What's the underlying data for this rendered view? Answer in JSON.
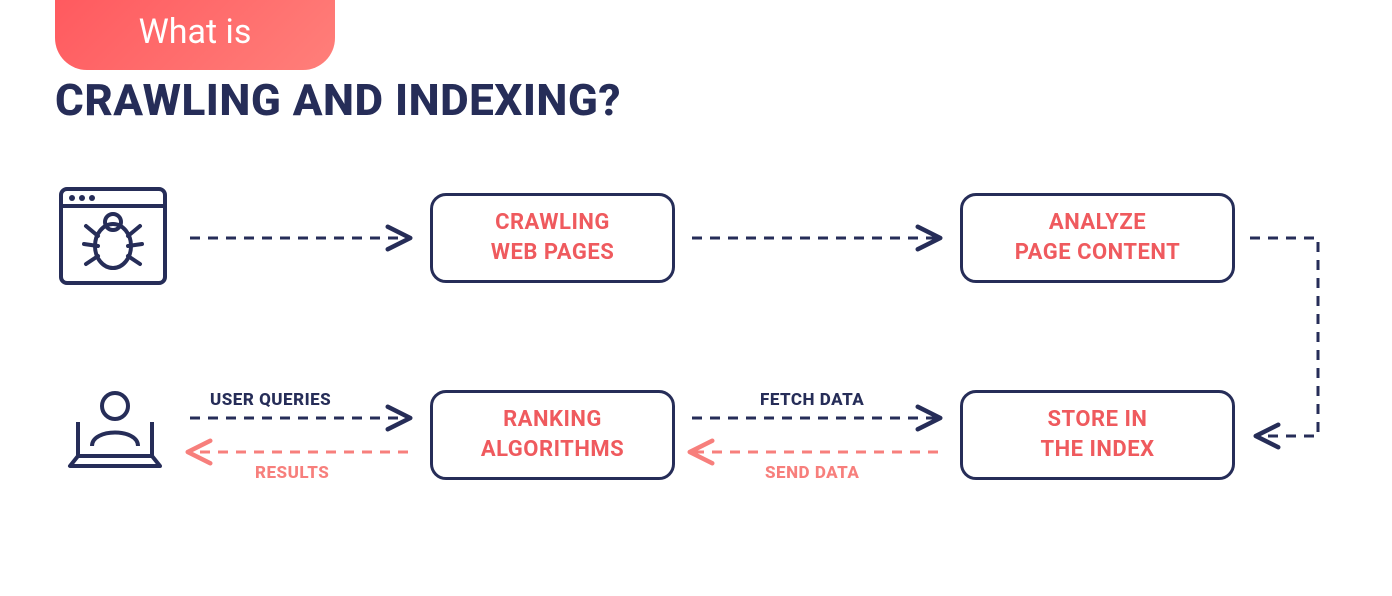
{
  "header": {
    "badge_text": "What is",
    "headline": "CRAWLING AND INDEXING?"
  },
  "nodes": {
    "crawler": {
      "label": "crawler-bot"
    },
    "crawling": {
      "line1": "CRAWLING",
      "line2": "WEB PAGES"
    },
    "analyze": {
      "line1": "ANALYZE",
      "line2": "PAGE CONTENT"
    },
    "store": {
      "line1": "STORE IN",
      "line2": "THE INDEX"
    },
    "ranking": {
      "line1": "RANKING",
      "line2": "ALGORITHMS"
    },
    "user": {
      "label": "user-laptop"
    }
  },
  "arrows": {
    "user_queries": "USER QUERIES",
    "results": "RESULTS",
    "fetch_data": "FETCH DATA",
    "send_data": "SEND DATA"
  },
  "colors": {
    "navy": "#262d58",
    "coral": "#f77f7c"
  }
}
